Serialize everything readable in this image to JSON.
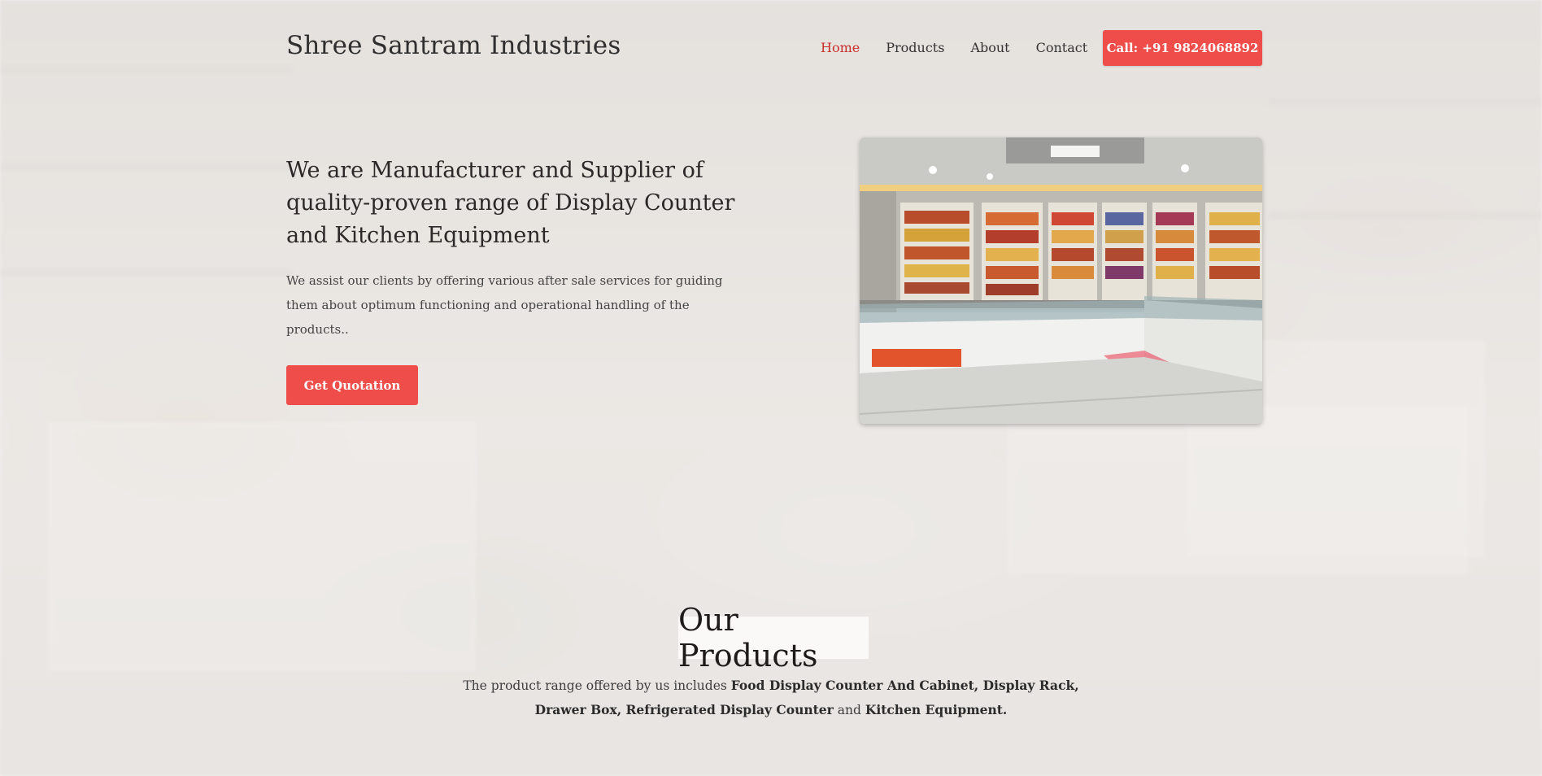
{
  "header": {
    "brand": "Shree Santram Industries",
    "nav": [
      {
        "label": "Home",
        "active": true
      },
      {
        "label": "Products",
        "active": false
      },
      {
        "label": "About",
        "active": false
      },
      {
        "label": "Contact",
        "active": false
      }
    ],
    "call_button": "Call: +91 9824068892"
  },
  "hero": {
    "title": "We are Manufacturer and Supplier of quality-proven range of Display Counter and Kitchen Equipment",
    "description": "We assist our clients by offering various after sale services for guiding them about optimum functioning and operational handling of the products..",
    "cta": "Get Quotation"
  },
  "products": {
    "title": "Our Products",
    "intro": "The product range offered by us includes",
    "item1": "Food Display Counter And Cabinet, Display Rack,",
    "item2": "Drawer Box, Refrigerated Display Counter",
    "joiner": "and",
    "item3": "Kitchen Equipment."
  },
  "colors": {
    "accent": "#ef4d4a",
    "nav_active": "#c9302c",
    "text": "#2b2b2b"
  }
}
